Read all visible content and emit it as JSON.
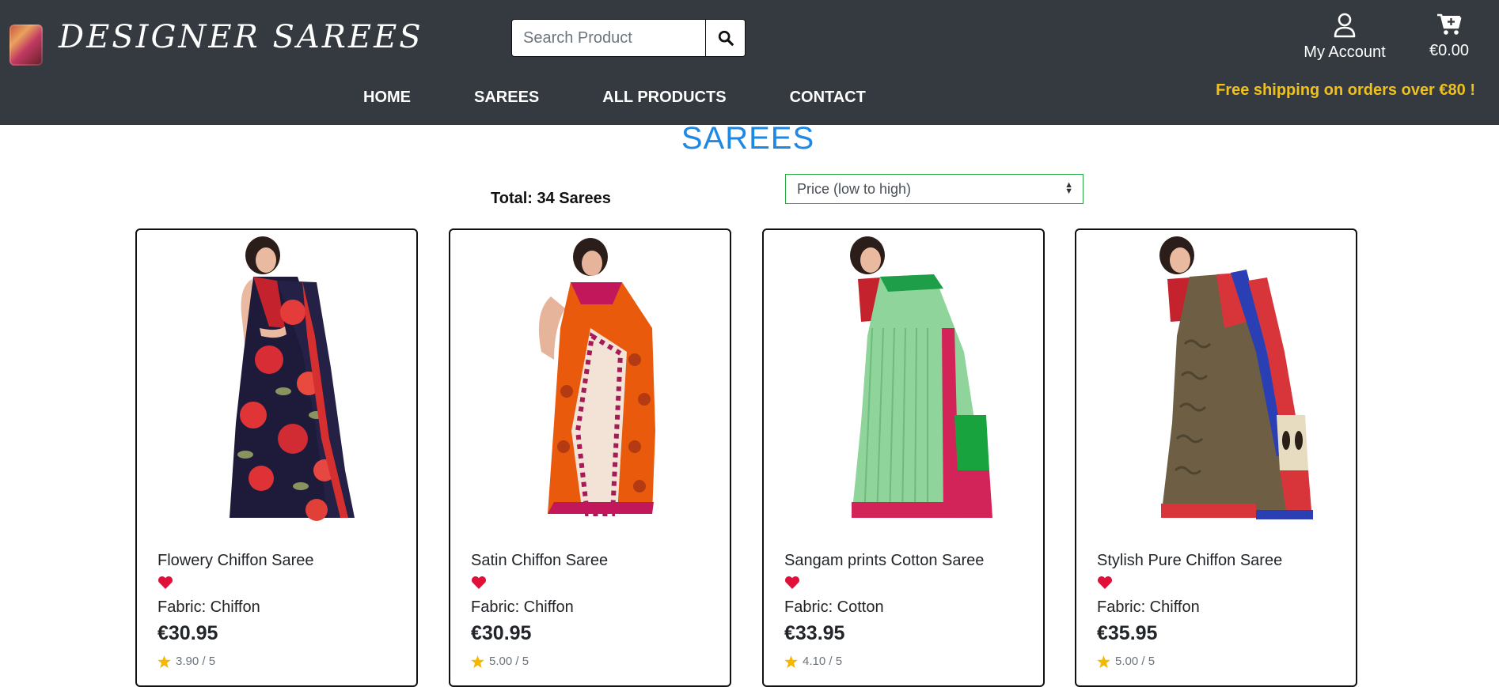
{
  "brand": {
    "name": "DESIGNER SAREES"
  },
  "search": {
    "placeholder": "Search Product"
  },
  "account": {
    "label": "My Account"
  },
  "cart": {
    "total": "€0.00"
  },
  "nav": [
    "HOME",
    "SAREES",
    "ALL PRODUCTS",
    "CONTACT"
  ],
  "promo": "Free shipping on orders over €80 !",
  "page_title": "SAREES",
  "total_label": "Total: 34 Sarees",
  "sort": {
    "selected": "Price (low to high)"
  },
  "colors": {
    "header_bg": "#343a40",
    "title_blue": "#1e88e5",
    "promo_yellow": "#f0c11a",
    "heart_red": "#e0103a",
    "star_yellow": "#f5b800"
  },
  "products": [
    {
      "name": "Flowery Chiffon Saree",
      "fabric": "Fabric: Chiffon",
      "price": "€30.95",
      "rating": "3.90 / 5"
    },
    {
      "name": "Satin Chiffon Saree",
      "fabric": "Fabric: Chiffon",
      "price": "€30.95",
      "rating": "5.00 / 5"
    },
    {
      "name": "Sangam prints Cotton Saree",
      "fabric": "Fabric: Cotton",
      "price": "€33.95",
      "rating": "4.10 / 5"
    },
    {
      "name": "Stylish Pure Chiffon Saree",
      "fabric": "Fabric: Chiffon",
      "price": "€35.95",
      "rating": "5.00 / 5"
    }
  ]
}
